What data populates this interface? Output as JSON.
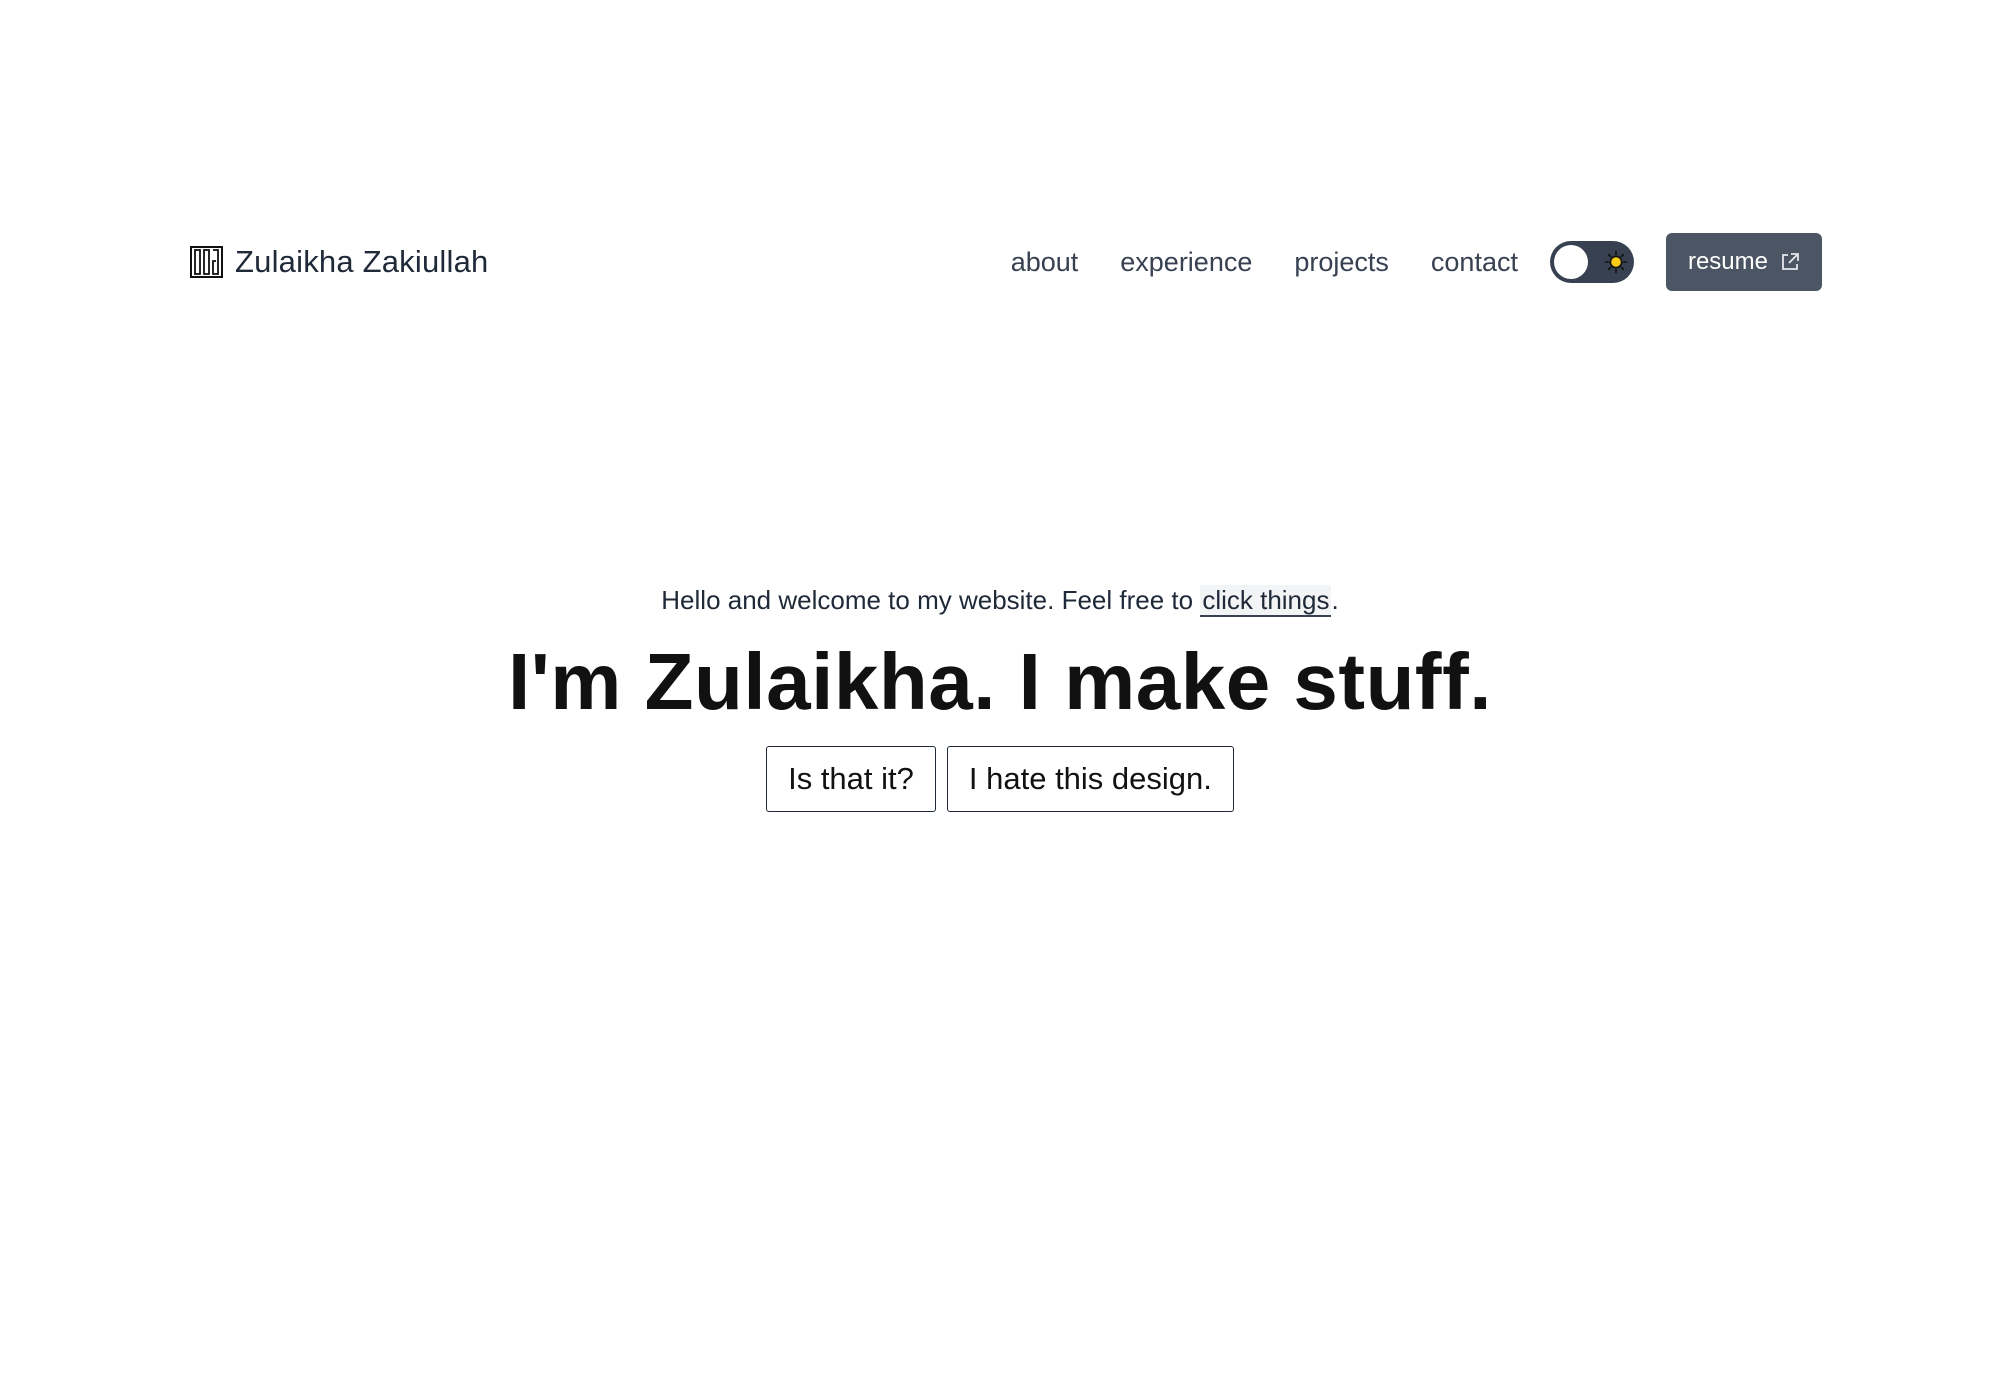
{
  "header": {
    "brand_name": "Zulaikha Zakiullah",
    "logo_icon": "logo-mark-icon",
    "nav_links": [
      {
        "label": "about"
      },
      {
        "label": "experience"
      },
      {
        "label": "projects"
      },
      {
        "label": "contact"
      }
    ],
    "theme_toggle": {
      "state": "light",
      "icon": "sun-icon",
      "track_color": "#374151",
      "sun_color": "#facc15"
    },
    "resume_button": {
      "label": "resume",
      "icon": "external-link-icon",
      "color": "#4b5563"
    }
  },
  "hero": {
    "tagline_prefix": "Hello and welcome to my website. Feel free to ",
    "tagline_link": "click things",
    "tagline_suffix": ".",
    "headline": "I'm Zulaikha. I make stuff.",
    "buttons": [
      {
        "label": "Is that it?"
      },
      {
        "label": "I hate this design."
      }
    ]
  }
}
